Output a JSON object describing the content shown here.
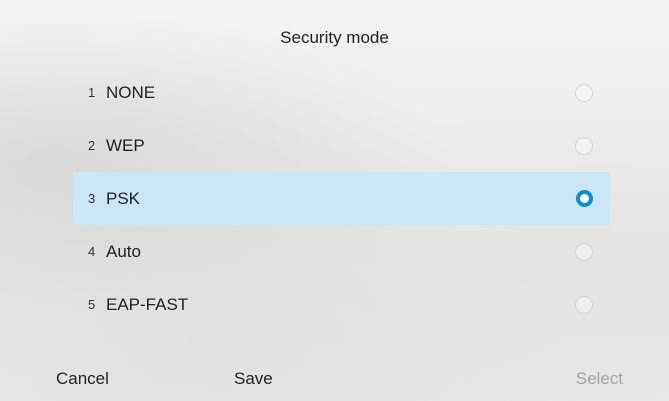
{
  "dialog": {
    "title": "Security mode"
  },
  "options": [
    {
      "number": "1",
      "label": "NONE",
      "selected": false
    },
    {
      "number": "2",
      "label": "WEP",
      "selected": false
    },
    {
      "number": "3",
      "label": "PSK",
      "selected": true
    },
    {
      "number": "4",
      "label": "Auto",
      "selected": false
    },
    {
      "number": "5",
      "label": "EAP-FAST",
      "selected": false
    }
  ],
  "softkeys": {
    "cancel": "Cancel",
    "save": "Save",
    "select": "Select"
  },
  "colors": {
    "selection_highlight": "#c9e7f5",
    "radio_accent": "#0a8fd0",
    "disabled_text": "#a5a5a5"
  }
}
